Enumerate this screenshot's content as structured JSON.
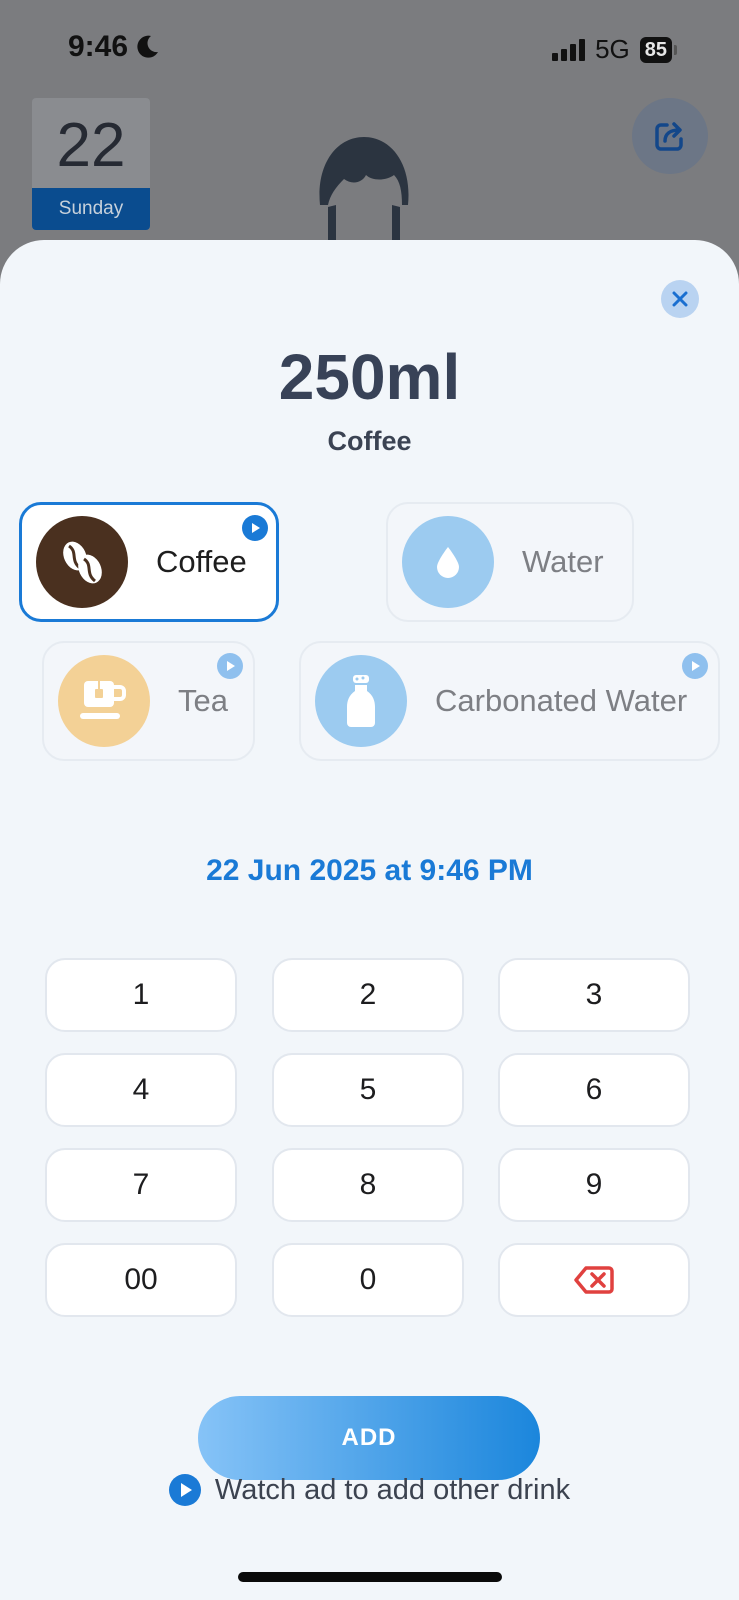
{
  "status_bar": {
    "time": "9:46",
    "network": "5G",
    "battery": "85"
  },
  "background_app": {
    "date_number": "22",
    "day_name": "Sunday"
  },
  "sheet": {
    "amount": "250ml",
    "drink_label": "Coffee",
    "drinks": [
      {
        "name": "Coffee",
        "selected": true,
        "ad_locked": true,
        "icon": "coffee-bean-icon",
        "color": "#4a301f"
      },
      {
        "name": "Water",
        "selected": false,
        "ad_locked": false,
        "icon": "water-drop-icon",
        "color": "#9ccbf0"
      },
      {
        "name": "Tea",
        "selected": false,
        "ad_locked": true,
        "icon": "tea-cup-icon",
        "color": "#f3d196"
      },
      {
        "name": "Carbonated Water",
        "selected": false,
        "ad_locked": true,
        "icon": "soda-bottle-icon",
        "color": "#9ccbf0"
      }
    ],
    "datetime": "22 Jun 2025 at 9:46 PM",
    "keypad": [
      "1",
      "2",
      "3",
      "4",
      "5",
      "6",
      "7",
      "8",
      "9",
      "00",
      "0"
    ],
    "add_label": "ADD",
    "watch_ad_label": "Watch ad to add other drink"
  },
  "colors": {
    "accent": "#1a7ad6",
    "delete": "#e0413f",
    "heading": "#384257"
  }
}
